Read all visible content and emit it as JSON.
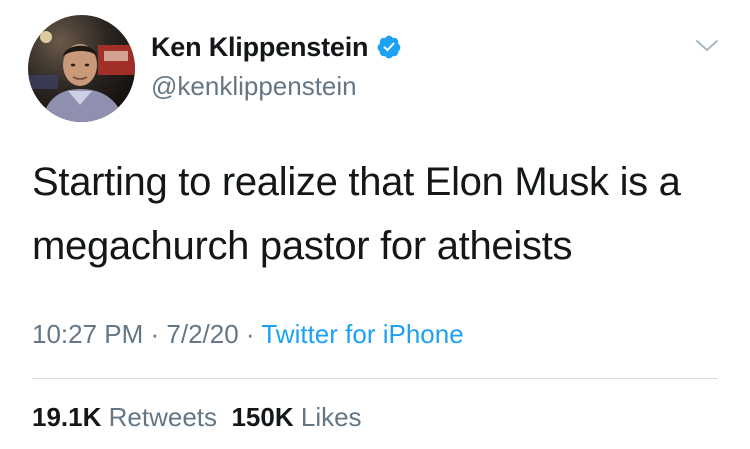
{
  "author": {
    "name": "Ken Klippenstein",
    "handle": "@kenklippenstein",
    "verified": true
  },
  "tweet": {
    "text": "Starting to realize that Elon Musk is a megachurch pastor for atheists"
  },
  "meta": {
    "time": "10:27 PM",
    "separator1": " · ",
    "date": "7/2/20",
    "separator2": " · ",
    "source": "Twitter for iPhone"
  },
  "stats": {
    "retweets_count": "19.1K",
    "retweets_label": "Retweets",
    "likes_count": "150K",
    "likes_label": "Likes"
  },
  "icons": {
    "avatar": "avatar",
    "verified": "verified-badge-icon",
    "menu": "chevron-down-icon"
  },
  "colors": {
    "text": "#14171a",
    "secondary": "#657786",
    "accent": "#1da1f2",
    "divider": "#d8dde1"
  }
}
